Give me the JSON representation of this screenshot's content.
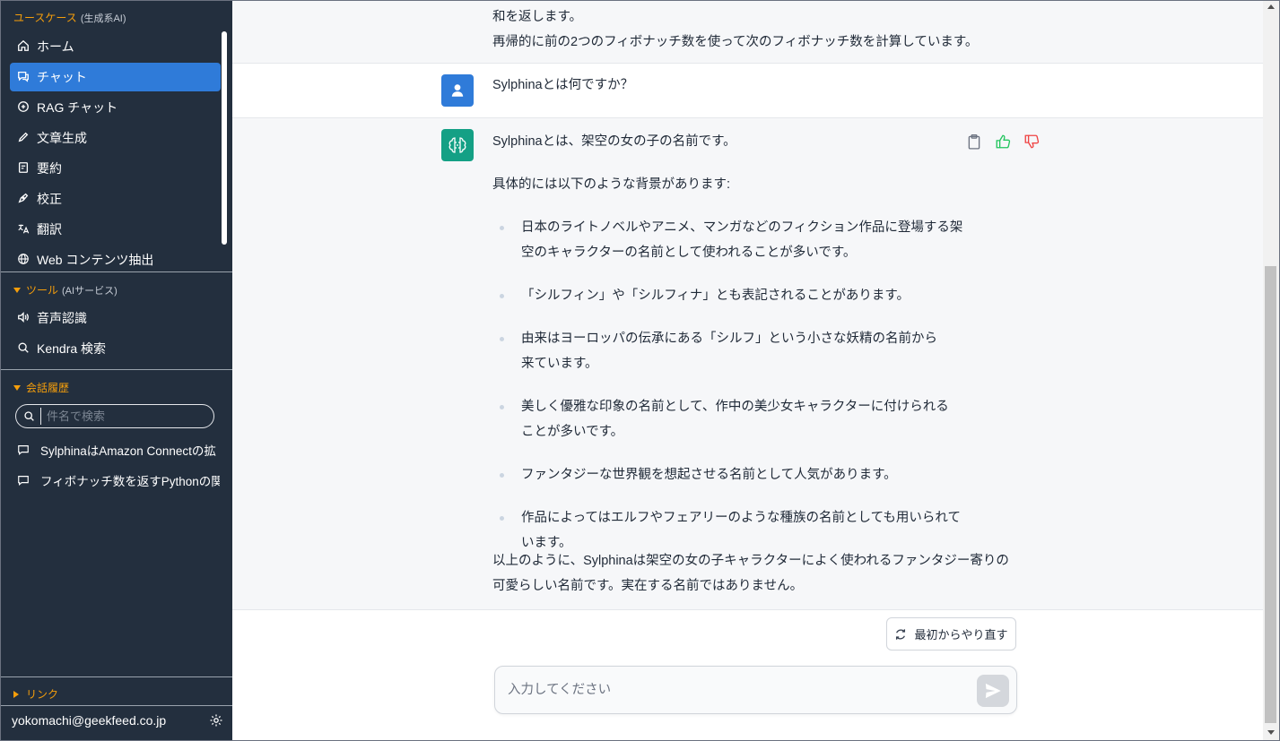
{
  "sidebar": {
    "usecase_title": "ユースケース",
    "usecase_sub": "(生成系AI)",
    "nav": [
      {
        "label": "ホーム",
        "icon": "home-icon"
      },
      {
        "label": "チャット",
        "icon": "chat-icon",
        "active": true
      },
      {
        "label": "RAG チャット",
        "icon": "rag-chat-icon"
      },
      {
        "label": "文章生成",
        "icon": "pencil-icon"
      },
      {
        "label": "要約",
        "icon": "summary-icon"
      },
      {
        "label": "校正",
        "icon": "pen-icon"
      },
      {
        "label": "翻訳",
        "icon": "translate-icon"
      },
      {
        "label": "Web コンテンツ抽出",
        "icon": "globe-icon"
      }
    ],
    "tools_title": "ツール",
    "tools_sub": "(AIサービス)",
    "tools": [
      {
        "label": "音声認識",
        "icon": "speaker-icon"
      },
      {
        "label": "Kendra 検索",
        "icon": "search-icon"
      }
    ],
    "history_title": "会話履歴",
    "history_search_placeholder": "件名で検索",
    "history": [
      {
        "label": "SylphinaはAmazon Connectの拡"
      },
      {
        "label": "フィボナッチ数を返すPythonの関数"
      }
    ],
    "link_title": "リンク",
    "user_email": "yokomachi@geekfeed.co.jp"
  },
  "chat": {
    "prev_lines": [
      "和を返します。",
      "再帰的に前の2つのフィボナッチ数を使って次のフィボナッチ数を計算しています。"
    ],
    "user_message": "Sylphinaとは何ですか？",
    "bot_intro": "Sylphinaとは、架空の女の子の名前です。",
    "bot_lead": "具体的には以下のような背景があります:",
    "bullets": [
      "日本のライトノベルやアニメ、マンガなどのフィクション作品に登場する架空のキャラクターの名前として使われることが多いです。",
      "「シルフィン」や「シルフィナ」とも表記されることがあります。",
      "由来はヨーロッパの伝承にある「シルフ」という小さな妖精の名前から来ています。",
      "美しく優雅な印象の名前として、作中の美少女キャラクターに付けられることが多いです。",
      "ファンタジーな世界観を想起させる名前として人気があります。",
      "作品によってはエルフやフェアリーのような種族の名前としても用いられています。"
    ],
    "bot_conclusion_1": "以上のように、Sylphinaは架空の女の子キャラクターによく使われるファンタジー寄りの",
    "bot_conclusion_2": "可愛らしい名前です。実在する名前ではありません。",
    "retry_label": "最初からやり直す",
    "input_placeholder": "入力してください"
  },
  "colors": {
    "sidebar_bg": "#232f3e",
    "active_nav": "#2f7bd9",
    "section_title": "#f59e0b",
    "bot_avatar": "#14a085",
    "thumbs_up": "#22c55e",
    "thumbs_down": "#ef4444"
  }
}
